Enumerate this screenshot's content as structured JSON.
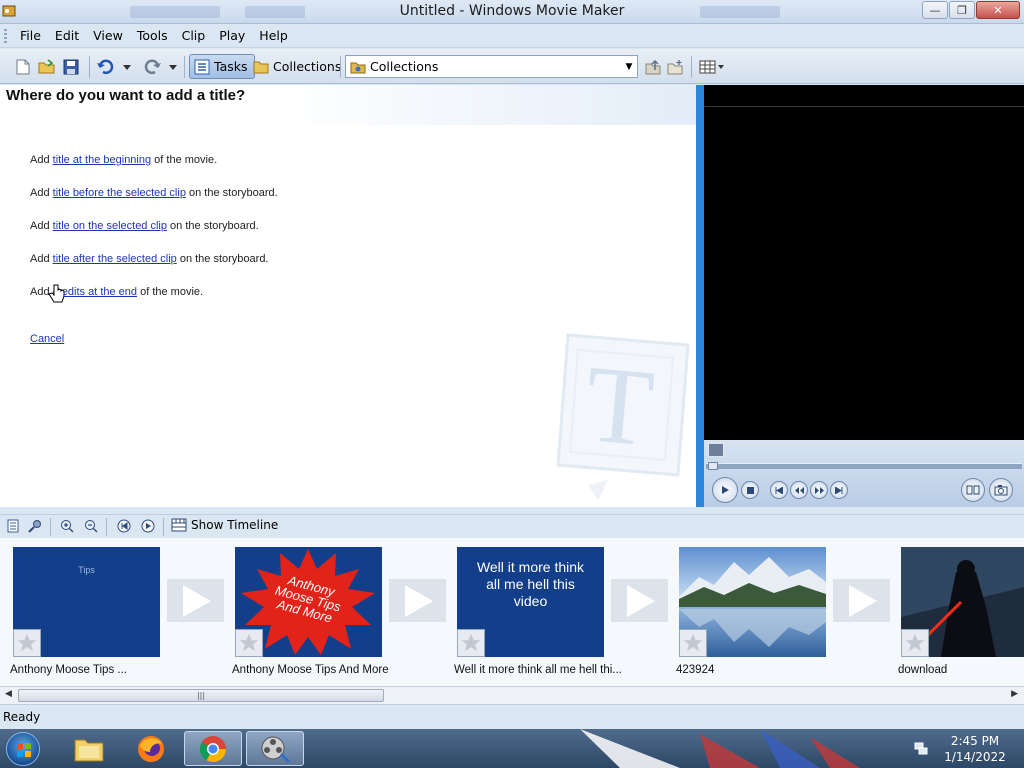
{
  "window": {
    "title": "Untitled - Windows Movie Maker",
    "buttons": [
      "minimize",
      "restore",
      "close"
    ]
  },
  "menu": [
    "File",
    "Edit",
    "View",
    "Tools",
    "Clip",
    "Play",
    "Help"
  ],
  "toolbar": {
    "tasks_label": "Tasks",
    "collections_label": "Collections",
    "combo_value": "Collections",
    "icons": [
      "new-project-icon",
      "open-project-icon",
      "save-project-icon",
      "undo-icon",
      "redo-icon",
      "up-folder-icon",
      "new-folder-icon",
      "views-icon"
    ]
  },
  "taskpane": {
    "heading": "Where do you want to add a title?",
    "options": [
      {
        "prefix": "Add ",
        "link": "title at the beginning",
        "suffix": " of the movie."
      },
      {
        "prefix": "Add ",
        "link": "title before the selected clip",
        "suffix": " on the storyboard."
      },
      {
        "prefix": "Add ",
        "link": "title on the selected clip",
        "suffix": " on the storyboard."
      },
      {
        "prefix": "Add ",
        "link": "title after the selected clip",
        "suffix": " on the storyboard."
      },
      {
        "prefix": "Add ",
        "link": "credits at the end",
        "suffix": " of the movie."
      }
    ],
    "cancel": "Cancel",
    "watermark_letter": "T"
  },
  "storyboard_toolbar": {
    "show_timeline": "Show Timeline"
  },
  "storyboard": {
    "clips": [
      {
        "label": "Anthony     Moose     Tips     ...",
        "thumb_text": "Tips",
        "kind": "title-blue"
      },
      {
        "label": "Anthony Moose Tips And More",
        "thumb_text": "Anthony Moose Tips And More",
        "kind": "starburst"
      },
      {
        "label": "Well it more think all me hell thi...",
        "thumb_text": "Well it more think all me hell this video",
        "kind": "title-blue-large"
      },
      {
        "label": "423924",
        "thumb_text": "",
        "kind": "landscape"
      },
      {
        "label": "download",
        "thumb_text": "",
        "kind": "dark-figure"
      }
    ]
  },
  "status": "Ready",
  "taskbar": {
    "time": "2:45 PM",
    "date": "1/14/2022",
    "apps": [
      "windows-explorer",
      "firefox",
      "chrome",
      "movie-maker"
    ]
  },
  "colors": {
    "link": "#1d36b4",
    "divider": "#2a86d8",
    "clip_blue": "#123e8a",
    "starburst_red": "#e2231a"
  }
}
